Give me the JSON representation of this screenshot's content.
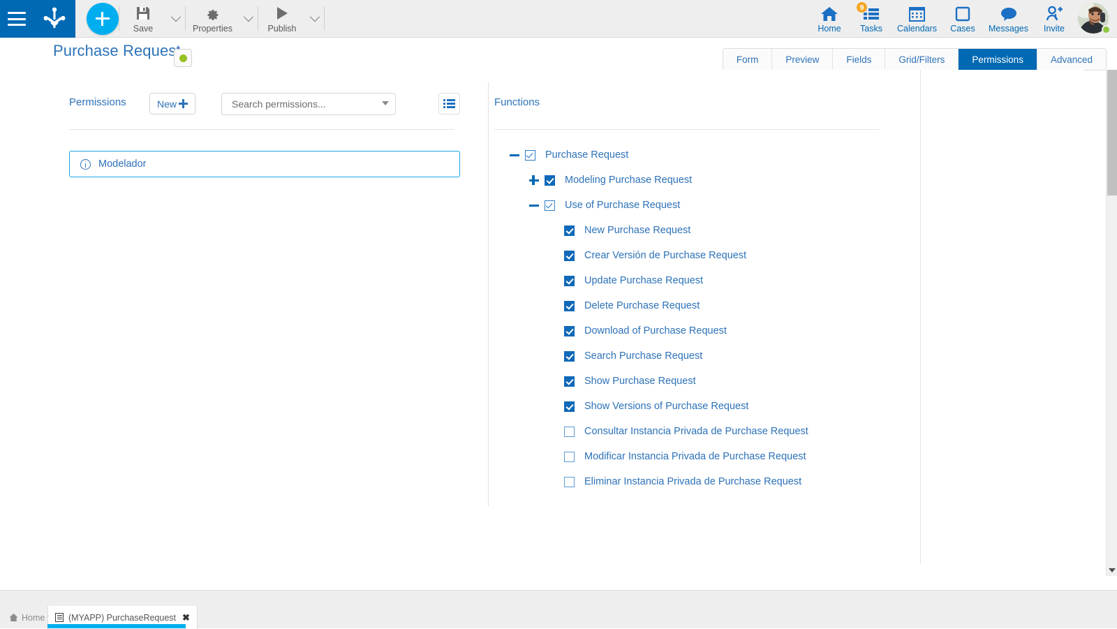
{
  "toolbar": {
    "menu_icon": "hamburger-icon",
    "logo_icon": "bizagi-logo-icon",
    "add_button_icon": "plus-icon",
    "buttons": [
      {
        "label": "Save",
        "icon": "save-icon"
      },
      {
        "label": "Properties",
        "icon": "gear-icon"
      },
      {
        "label": "Publish",
        "icon": "play-icon"
      }
    ],
    "nav": [
      {
        "label": "Home",
        "icon": "home-icon",
        "badge": ""
      },
      {
        "label": "Tasks",
        "icon": "tasks-icon",
        "badge": "9"
      },
      {
        "label": "Calendars",
        "icon": "calendar-icon",
        "badge": ""
      },
      {
        "label": "Cases",
        "icon": "case-icon",
        "badge": ""
      },
      {
        "label": "Messages",
        "icon": "message-icon",
        "badge": ""
      },
      {
        "label": "Invite",
        "icon": "invite-user-icon",
        "badge": ""
      }
    ],
    "avatar": {
      "name": "avatar",
      "status": "online"
    }
  },
  "header": {
    "title": "Purchase Request",
    "status_color": "#96c024",
    "tabs": [
      {
        "label": "Form",
        "active": false
      },
      {
        "label": "Preview",
        "active": false
      },
      {
        "label": "Fields",
        "active": false
      },
      {
        "label": "Grid/Filters",
        "active": false
      },
      {
        "label": "Permissions",
        "active": true
      },
      {
        "label": "Advanced",
        "active": false
      }
    ]
  },
  "permissions_panel": {
    "title": "Permissions",
    "new_button": "New",
    "search_placeholder": "Search permissions...",
    "search_value": "",
    "list_view_icon": "list-view-icon",
    "rows": [
      {
        "label": "Modelador",
        "icon": "info-icon",
        "selected": true
      }
    ]
  },
  "functions_panel": {
    "title": "Functions",
    "tree": [
      {
        "label": "Purchase Request",
        "indent": 0,
        "toggle": "minus",
        "check": "light"
      },
      {
        "label": "Modeling Purchase Request",
        "indent": 1,
        "toggle": "plus",
        "check": "solid"
      },
      {
        "label": "Use of Purchase Request",
        "indent": 1,
        "toggle": "minus",
        "check": "light"
      },
      {
        "label": "New Purchase Request",
        "indent": 2,
        "toggle": "none",
        "check": "solid"
      },
      {
        "label": "Crear Versión de Purchase Request",
        "indent": 2,
        "toggle": "none",
        "check": "solid"
      },
      {
        "label": "Update Purchase Request",
        "indent": 2,
        "toggle": "none",
        "check": "solid"
      },
      {
        "label": "Delete Purchase Request",
        "indent": 2,
        "toggle": "none",
        "check": "solid"
      },
      {
        "label": "Download of Purchase Request",
        "indent": 2,
        "toggle": "none",
        "check": "solid"
      },
      {
        "label": "Search Purchase Request",
        "indent": 2,
        "toggle": "none",
        "check": "solid"
      },
      {
        "label": "Show Purchase Request",
        "indent": 2,
        "toggle": "none",
        "check": "solid"
      },
      {
        "label": "Show Versions of Purchase Request",
        "indent": 2,
        "toggle": "none",
        "check": "solid"
      },
      {
        "label": "Consultar Instancia Privada de Purchase Request",
        "indent": 2,
        "toggle": "none",
        "check": "empty"
      },
      {
        "label": "Modificar Instancia Privada de Purchase Request",
        "indent": 2,
        "toggle": "none",
        "check": "empty"
      },
      {
        "label": "Eliminar Instancia Privada de Purchase Request",
        "indent": 2,
        "toggle": "none",
        "check": "empty"
      }
    ]
  },
  "scrollbar": {
    "orientation": "vertical",
    "thumb_top_pct": 0,
    "thumb_height_pct": 25
  },
  "taskbar": {
    "home_label": "Home",
    "tab_label": "(MYAPP) PurchaseRequest",
    "close_glyph": "✖",
    "active_color": "#00aeef"
  },
  "colors": {
    "brand_blue": "#0069b4",
    "accent_cyan": "#00aeef",
    "link_blue": "#2d72b8",
    "badge_orange": "#f5a623",
    "status_green": "#96c024"
  }
}
